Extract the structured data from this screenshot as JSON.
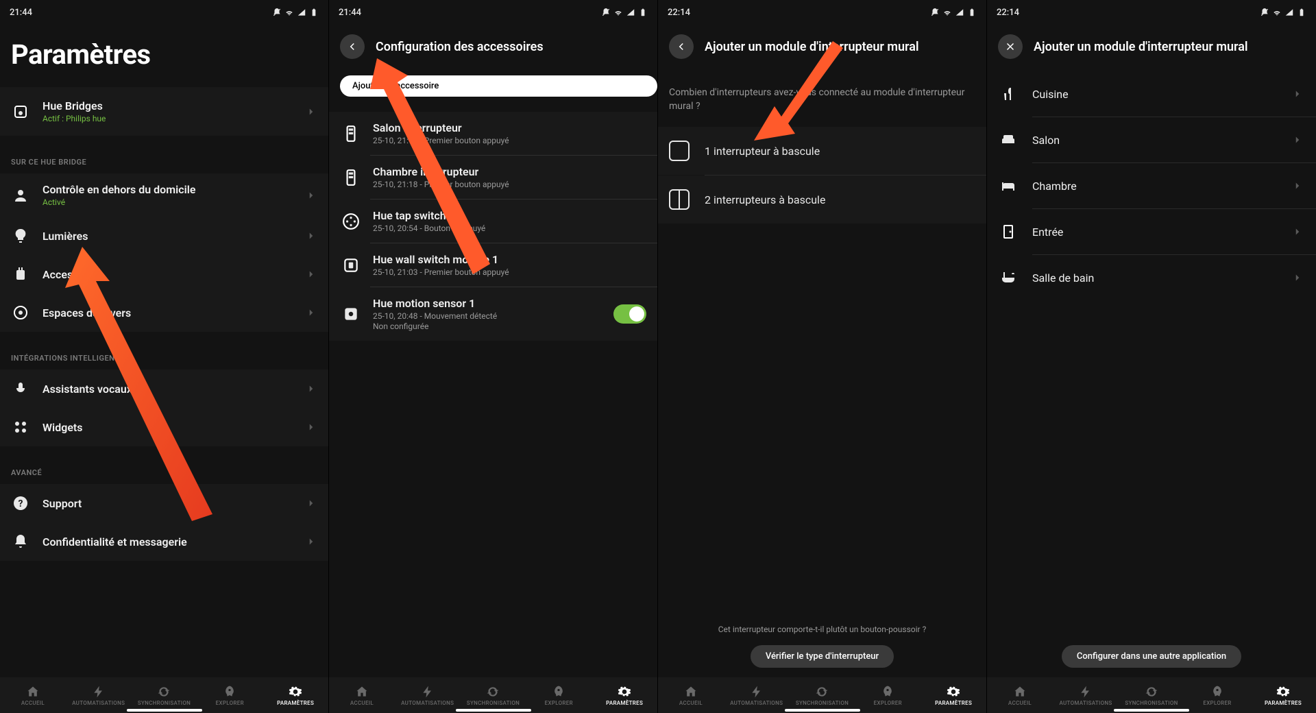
{
  "status": {
    "t1": "21:44",
    "t2": "21:44",
    "t3": "22:14",
    "t4": "22:14"
  },
  "nav": {
    "home": "ACCUEIL",
    "automations": "AUTOMATISATIONS",
    "sync": "SYNCHRONISATION",
    "explore": "EXPLORER",
    "settings": "PARAMÈTRES"
  },
  "s1": {
    "title": "Paramètres",
    "bridges": {
      "title": "Hue Bridges",
      "sub": "Actif : Philips hue"
    },
    "sec1_label": "SUR CE HUE BRIDGE",
    "remote": {
      "title": "Contrôle en dehors du domicile",
      "sub": "Activé"
    },
    "lights": {
      "title": "Lumières"
    },
    "acc": {
      "title": "Accessoires"
    },
    "spaces": {
      "title": "Espaces de divers"
    },
    "sec2_label": "INTÉGRATIONS INTELLIGENTES",
    "voice": {
      "title": "Assistants vocaux"
    },
    "widgets": {
      "title": "Widgets"
    },
    "sec3_label": "AVANCÉ",
    "support": {
      "title": "Support"
    },
    "privacy": {
      "title": "Confidentialité et messagerie"
    }
  },
  "s2": {
    "title": "Configuration des accessoires",
    "add_btn": "Ajouter un accessoire",
    "items": [
      {
        "title": "Salon interrupteur",
        "sub": "25-10, 21:18 - Premier bouton appuyé"
      },
      {
        "title": "Chambre interrupteur",
        "sub": "25-10, 21:18 - Premier bouton appuyé"
      },
      {
        "title": "Hue tap switch 1",
        "sub": "25-10, 20:54 - Bouton 1 appuyé"
      },
      {
        "title": "Hue wall switch module 1",
        "sub": "25-10, 21:03 - Premier bouton appuyé"
      },
      {
        "title": "Hue motion sensor 1",
        "sub": "25-10, 20:48 - Mouvement détecté",
        "sub2": "Non configurée",
        "toggle": true
      }
    ]
  },
  "s3": {
    "title": "Ajouter un module d'interrupteur mural",
    "question": "Combien d'interrupteurs avez-vous connecté au module d'interrupteur mural ?",
    "opt1": "1 interrupteur à bascule",
    "opt2": "2 interrupteurs à bascule",
    "cta_q": "Cet interrupteur comporte-t-il plutôt un bouton-poussoir ?",
    "cta_btn": "Vérifier le type d'interrupteur"
  },
  "s4": {
    "title": "Ajouter un module d'interrupteur mural",
    "rooms": [
      "Cuisine",
      "Salon",
      "Chambre",
      "Entrée",
      "Salle de bain"
    ],
    "cta_btn": "Configurer dans une autre application"
  }
}
